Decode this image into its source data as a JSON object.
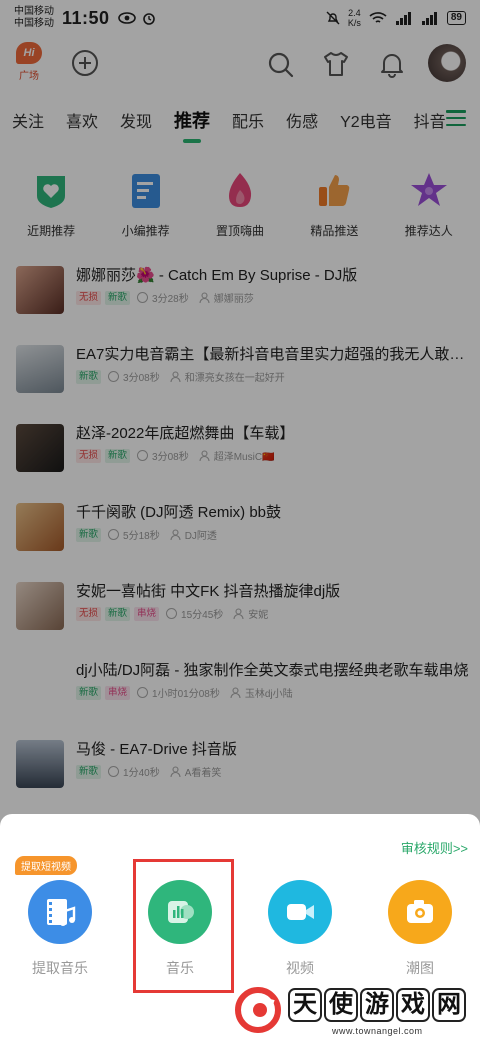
{
  "status_bar": {
    "carrier1": "中国移动",
    "carrier2": "中国移动",
    "time": "11:50",
    "speed_value": "2.4",
    "speed_unit": "K/s",
    "battery": "89"
  },
  "header": {
    "plaza_badge": "Hi",
    "plaza_label": "广场"
  },
  "tabs": [
    {
      "label": "关注"
    },
    {
      "label": "喜欢"
    },
    {
      "label": "发现"
    },
    {
      "label": "推荐",
      "active": true
    },
    {
      "label": "配乐"
    },
    {
      "label": "伤感"
    },
    {
      "label": "Y2电音"
    },
    {
      "label": "抖音"
    }
  ],
  "categories": [
    {
      "label": "近期推荐",
      "icon": "shield-heart-icon",
      "color": "#2fb67c"
    },
    {
      "label": "小编推荐",
      "icon": "notebook-icon",
      "color": "#3c8de0"
    },
    {
      "label": "置顶嗨曲",
      "icon": "flame-icon",
      "color": "#e8477a"
    },
    {
      "label": "精品推送",
      "icon": "thumbs-up-icon",
      "color": "#f07a28"
    },
    {
      "label": "推荐达人",
      "icon": "star-icon",
      "color": "#9b4fd8"
    }
  ],
  "songs": [
    {
      "title": "娜娜丽莎🌺 - Catch Em By Suprise - DJ版",
      "badges": [
        {
          "text": "无损",
          "type": "wusun"
        },
        {
          "text": "新歌",
          "type": "xin"
        }
      ],
      "duration": "3分28秒",
      "author": "娜娜丽莎",
      "cover_color": "#8a5a4a"
    },
    {
      "title": "EA7实力电音霸主【最新抖音电音里实力超强的我无人敢惹…",
      "badges": [
        {
          "text": "新歌",
          "type": "xin"
        }
      ],
      "duration": "3分08秒",
      "author": "和漂亮女孩在一起好开",
      "cover_color": "#9aa6ae"
    },
    {
      "title": "赵泽-2022年底超燃舞曲【车载】",
      "badges": [
        {
          "text": "无损",
          "type": "wusun"
        },
        {
          "text": "新歌",
          "type": "xin"
        }
      ],
      "duration": "3分08秒",
      "author": "超泽MusiC🇨🇳",
      "cover_color": "#2c2c2c"
    },
    {
      "title": "千千阕歌 (DJ阿透 Remix) bb鼓",
      "badges": [
        {
          "text": "新歌",
          "type": "xin"
        }
      ],
      "duration": "5分18秒",
      "author": "DJ阿透",
      "cover_color": "#c8945a"
    },
    {
      "title": "安妮一喜帖街 中文FK 抖音热播旋律dj版",
      "badges": [
        {
          "text": "无损",
          "type": "wusun"
        },
        {
          "text": "新歌",
          "type": "xin"
        },
        {
          "text": "串烧",
          "type": "re"
        }
      ],
      "duration": "15分45秒",
      "author": "安妮",
      "cover_color": "#b89a88"
    },
    {
      "title": "dj小陆/DJ阿磊 - 独家制作全英文泰式电摆经典老歌车载串烧",
      "badges": [
        {
          "text": "新歌",
          "type": "xin"
        },
        {
          "text": "串烧",
          "type": "re"
        }
      ],
      "duration": "1小时01分08秒",
      "author": "玉林dj小陆",
      "cover_color": ""
    },
    {
      "title": "马俊 - EA7-Drive 抖音版",
      "badges": [
        {
          "text": "新歌",
          "type": "xin"
        }
      ],
      "duration": "1分40秒",
      "author": "A看着笑",
      "cover_color": "#6d7f96"
    }
  ],
  "sheet": {
    "review_link": "审核规则>>",
    "extract_badge": "提取短视频",
    "items": [
      {
        "label": "提取音乐",
        "icon": "film-music-icon",
        "color": "#3d8de6"
      },
      {
        "label": "音乐",
        "icon": "music-card-icon",
        "color": "#2fb67c"
      },
      {
        "label": "视频",
        "icon": "video-camera-icon",
        "color": "#1fb8e0"
      },
      {
        "label": "潮图",
        "icon": "camera-icon",
        "color": "#f7a81b"
      }
    ]
  },
  "watermark": {
    "chars": [
      "天",
      "使",
      "游",
      "戏",
      "网"
    ],
    "url": "www.townangel.com"
  }
}
